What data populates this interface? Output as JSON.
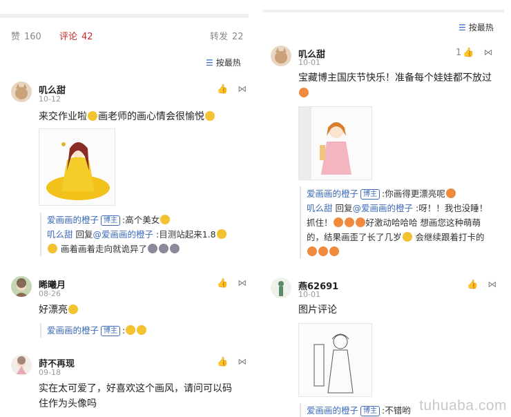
{
  "stats": {
    "likes_label": "赞",
    "likes_count": "160",
    "comments_label": "评论",
    "comments_count": "42",
    "reposts_label": "转发",
    "reposts_count": "22"
  },
  "sort_label": "按最热",
  "left_comments": {
    "c1": {
      "user": "叽么甜",
      "date": "10-12",
      "text": "来交作业啦",
      "text_b": "画老师的画心情会很愉悦",
      "replies": {
        "r1_user": "爱画画的橙子",
        "badge": "博主",
        "r1_text": ":高个美女",
        "r2_user": "叽么甜",
        "r2_reply": "回复",
        "r2_at": "@爱画画的橙子",
        "r2_text": ":目测站起来1.8",
        "r2_line2": "画着画着走向就诡异了"
      }
    },
    "c2": {
      "user": "睎曦月",
      "date": "08-26",
      "text": "好漂亮",
      "replies": {
        "r1_user": "爱画画的橙子",
        "badge": "博主"
      }
    },
    "c3": {
      "user": "莳不再现",
      "date": "09-18",
      "line1": "实在太可爱了，好喜欢这个画风，请问可以码",
      "line2": "住作为头像吗"
    }
  },
  "right_comments": {
    "c1": {
      "user": "叽么甜",
      "date": "10-01",
      "likes": "1",
      "text": "宝藏博主国庆节快乐！准备每个娃娃都不放过",
      "replies": {
        "r1_user": "爱画画的橙子",
        "badge": "博主",
        "r1_text": ":你画得更漂亮呢",
        "r2_user": "叽么甜",
        "r2_reply": "回复",
        "r2_at": "@爱画画的橙子",
        "r2_text": ":呀！！我也没睡！",
        "r2_line2a": "抓住！",
        "r2_line2b": "好激动哈哈哈 想画您这种萌萌",
        "r2_line3": "的，结果画歪了长了几岁",
        "r2_line3b": " 会继续跟着打卡的"
      }
    },
    "c2": {
      "user": "燕62691",
      "date": "10-01",
      "text": "图片评论",
      "replies": {
        "r1_user": "爱画画的橙子",
        "badge": "博主",
        "r1_text": ":不错哟"
      }
    }
  },
  "watermark": "tuhuaba.com"
}
